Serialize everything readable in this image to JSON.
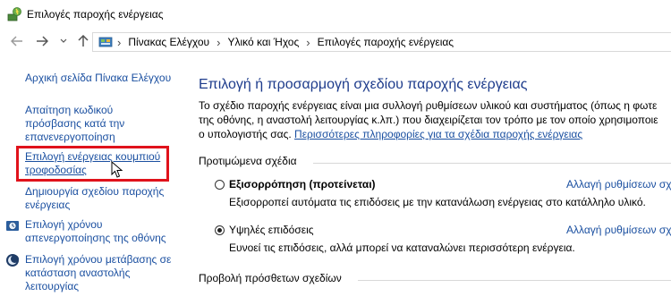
{
  "window": {
    "title": "Επιλογές παροχής ενέργειας"
  },
  "breadcrumb": [
    "Πίνακας Ελέγχου",
    "Υλικό και Ήχος",
    "Επιλογές παροχής ενέργειας"
  ],
  "sidebar": {
    "items": [
      {
        "label": "Αρχική σελίδα Πίνακα Ελέγχου"
      },
      {
        "label_lines": [
          "Απαίτηση κωδικού",
          "πρόσβασης κατά την",
          "επανενεργοποίηση"
        ]
      },
      {
        "label_lines": [
          "Επιλογή ενέργειας κουμπιού",
          "τροφοδοσίας"
        ]
      },
      {
        "label_lines": [
          "Δημιουργία σχεδίου παροχής",
          "ενέργειας"
        ]
      },
      {
        "label_lines": [
          "Επιλογή χρόνου",
          "απενεργοποίησης της οθόνης"
        ],
        "icon": "clock-icon"
      },
      {
        "label_lines": [
          "Επιλογή χρόνου μετάβασης σε",
          "κατάσταση αναστολής",
          "λειτουργίας"
        ],
        "icon": "moon-icon"
      }
    ]
  },
  "main": {
    "heading": "Επιλογή ή προσαρμογή σχεδίου παροχής ενέργειας",
    "intro_lines": [
      "Το σχέδιο παροχής ενέργειας είναι μια συλλογή ρυθμίσεων υλικού και συστήματος (όπως η φωτε",
      "της οθόνης, η αναστολή λειτουργίας κ.λπ.) που διαχειρίζεται τον τρόπο με τον οποίο χρησιμοποιε",
      "ο υπολογιστής σας."
    ],
    "intro_link": "Περισσότερες πληροφορίες για τα σχέδια παροχής ενέργειας",
    "preferred_title": "Προτιμώμενα σχέδια",
    "plans": [
      {
        "name": "Εξισορρόπηση (προτείνεται)",
        "desc": "Εξισορροπεί αυτόματα τις επιδόσεις με την κατανάλωση ενέργειας στο κατάλληλο υλικό.",
        "link": "Αλλαγή ρυθμίσεων σχ",
        "selected": false
      },
      {
        "name": "Υψηλές επιδόσεις",
        "desc": "Ευνοεί τις επιδόσεις, αλλά μπορεί να καταναλώνει περισσότερη ενέργεια.",
        "link": "Αλλαγή ρυθμίσεων σχ",
        "selected": true
      }
    ],
    "additional_title": "Προβολή πρόσθετων σχεδίων"
  },
  "colors": {
    "link": "#1a4fa0",
    "heading": "#1e3c8c",
    "highlight": "#e0121b"
  }
}
